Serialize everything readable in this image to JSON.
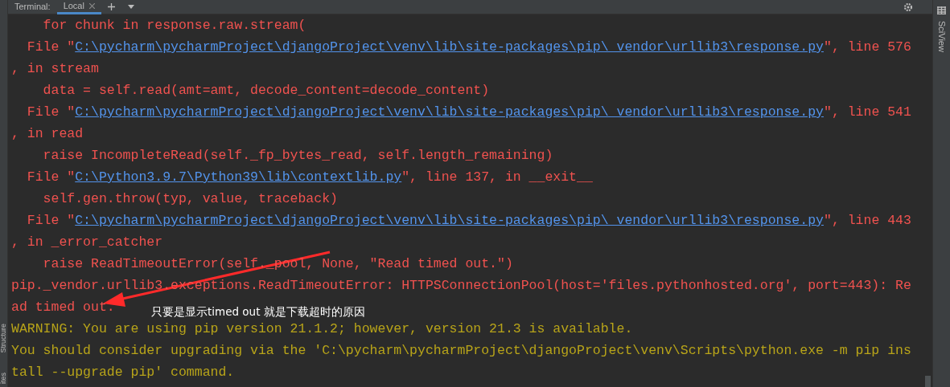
{
  "tool_window": {
    "title": "Terminal:",
    "tabs": [
      {
        "label": "Local",
        "selected": true
      }
    ],
    "side_left": [
      "Structure",
      "ites"
    ],
    "side_right": [
      "SciView"
    ]
  },
  "lines": [
    {
      "kind": "error",
      "segments": [
        {
          "kind": "text",
          "text": "    for chunk in response.raw.stream("
        }
      ]
    },
    {
      "kind": "error",
      "segments": [
        {
          "kind": "text",
          "text": "  File \""
        },
        {
          "kind": "link",
          "text": "C:\\pycharm\\pycharmProject\\djangoProject\\venv\\lib\\site-packages\\pip\\_vendor\\urllib3\\response.py"
        },
        {
          "kind": "text",
          "text": "\", line 576"
        }
      ]
    },
    {
      "kind": "error",
      "segments": [
        {
          "kind": "text",
          "text": ", in stream"
        }
      ]
    },
    {
      "kind": "error",
      "segments": [
        {
          "kind": "text",
          "text": "    data = self.read(amt=amt, decode_content=decode_content)"
        }
      ]
    },
    {
      "kind": "error",
      "segments": [
        {
          "kind": "text",
          "text": "  File \""
        },
        {
          "kind": "link",
          "text": "C:\\pycharm\\pycharmProject\\djangoProject\\venv\\lib\\site-packages\\pip\\_vendor\\urllib3\\response.py"
        },
        {
          "kind": "text",
          "text": "\", line 541"
        }
      ]
    },
    {
      "kind": "error",
      "segments": [
        {
          "kind": "text",
          "text": ", in read"
        }
      ]
    },
    {
      "kind": "error",
      "segments": [
        {
          "kind": "text",
          "text": "    raise IncompleteRead(self._fp_bytes_read, self.length_remaining)"
        }
      ]
    },
    {
      "kind": "error",
      "segments": [
        {
          "kind": "text",
          "text": "  File \""
        },
        {
          "kind": "link",
          "text": "C:\\Python3.9.7\\Python39\\lib\\contextlib.py"
        },
        {
          "kind": "text",
          "text": "\", line 137, in __exit__"
        }
      ]
    },
    {
      "kind": "error",
      "segments": [
        {
          "kind": "text",
          "text": "    self.gen.throw(typ, value, traceback)"
        }
      ]
    },
    {
      "kind": "error",
      "segments": [
        {
          "kind": "text",
          "text": "  File \""
        },
        {
          "kind": "link",
          "text": "C:\\pycharm\\pycharmProject\\djangoProject\\venv\\lib\\site-packages\\pip\\_vendor\\urllib3\\response.py"
        },
        {
          "kind": "text",
          "text": "\", line 443"
        }
      ]
    },
    {
      "kind": "error",
      "segments": [
        {
          "kind": "text",
          "text": ", in _error_catcher"
        }
      ]
    },
    {
      "kind": "error",
      "segments": [
        {
          "kind": "text",
          "text": "    raise ReadTimeoutError(self._pool, None, \"Read timed out.\")"
        }
      ]
    },
    {
      "kind": "error",
      "segments": [
        {
          "kind": "text",
          "text": "pip._vendor.urllib3.exceptions.ReadTimeoutError: HTTPSConnectionPool(host='files.pythonhosted.org', port=443): Re"
        }
      ]
    },
    {
      "kind": "error",
      "segments": [
        {
          "kind": "text",
          "text": "ad timed out."
        }
      ]
    },
    {
      "kind": "warning",
      "segments": [
        {
          "kind": "text",
          "text": "WARNING: You are using pip version 21.1.2; however, version 21.3 is available."
        }
      ]
    },
    {
      "kind": "warning",
      "segments": [
        {
          "kind": "text",
          "text": "You should consider upgrading via the 'C:\\pycharm\\pycharmProject\\djangoProject\\venv\\Scripts\\python.exe -m pip ins"
        }
      ]
    },
    {
      "kind": "warning",
      "segments": [
        {
          "kind": "text",
          "text": "tall --upgrade pip' command."
        }
      ]
    }
  ],
  "annotation": {
    "text": "只要是显示timed out 就是下载超时的原因"
  }
}
